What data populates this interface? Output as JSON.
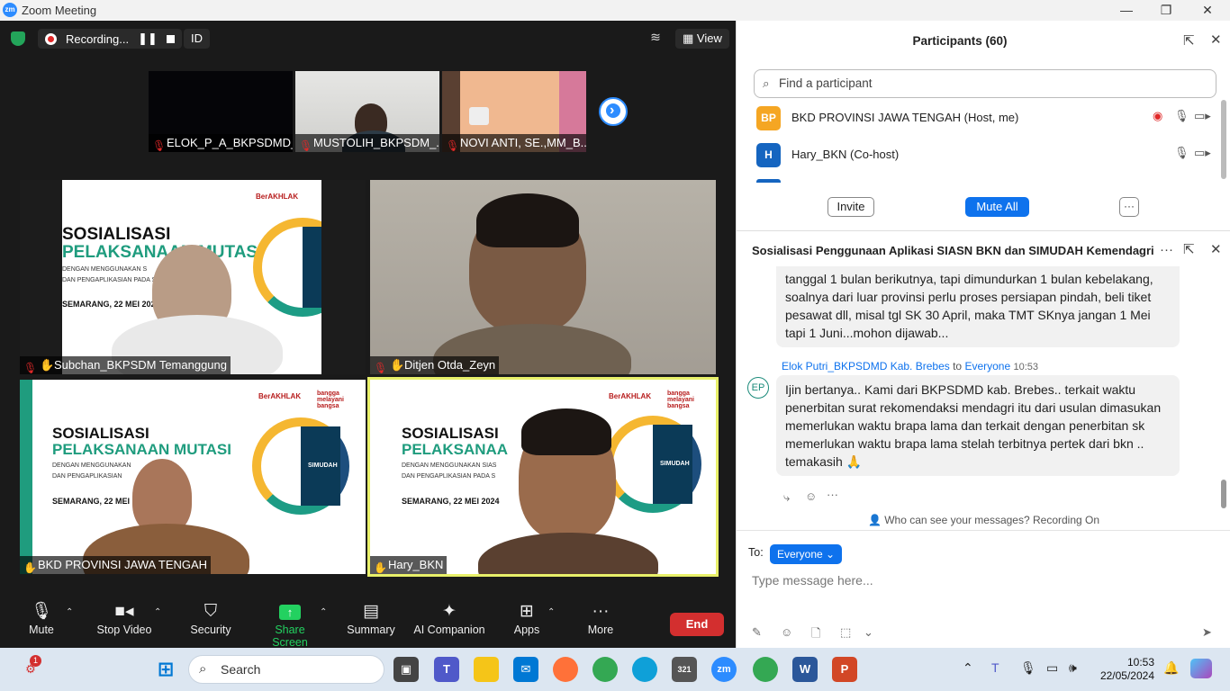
{
  "window": {
    "title": "Zoom Meeting",
    "logo": "zm"
  },
  "topbar": {
    "recording": "Recording...",
    "id_label": "ID",
    "view_label": "View"
  },
  "thumbnails": [
    {
      "name": "ELOK_P_A_BKPSDMD_..."
    },
    {
      "name": "MUSTOLIH_BKPSDM_..."
    },
    {
      "name": "NOVI ANTI, SE.,MM_B..."
    }
  ],
  "tiles": [
    {
      "name": "Subchan_BKPSDM Temanggung",
      "slide": {
        "line1": "SOSIALISASI",
        "line2": "PELAKSANAAN MUTASI",
        "line3": "DENGAN MENGGUNAKAN S",
        "line4": "DAN PENGAPLIKASIAN PADA S",
        "date": "SEMARANG, 22 MEI 2024",
        "badge": "BerAKHLAK"
      }
    },
    {
      "name": "Ditjen Otda_Zeyn"
    },
    {
      "name": "BKD PROVINSI JAWA TENGAH",
      "slide": {
        "line1": "SOSIALISASI",
        "line2": "PELAKSANAAN MUTASI",
        "line3": "DENGAN MENGGUNAKAN",
        "line4": "DAN PENGAPLIKASIAN",
        "date": "SEMARANG, 22 MEI",
        "badge": "BerAKHLAK",
        "badge2": "bangga melayani bangsa",
        "simudah": "SIMUDAH"
      }
    },
    {
      "name": "Hary_BKN",
      "slide": {
        "line1": "SOSIALISASI",
        "line2": "PELAKSANAA",
        "line3": "DENGAN MENGGUNAKAN SIAS",
        "line4": "DAN PENGAPLIKASIAN PADA S",
        "date": "SEMARANG, 22 MEI 2024",
        "badge": "BerAKHLAK",
        "badge2": "bangga melayani bangsa",
        "simudah": "SIMUDAH"
      }
    }
  ],
  "toolbar": {
    "mute": "Mute",
    "stop_video": "Stop Video",
    "security": "Security",
    "share_screen": "Share Screen",
    "summary": "Summary",
    "ai_companion": "AI Companion",
    "apps": "Apps",
    "more": "More",
    "end": "End"
  },
  "participants": {
    "title": "Participants (60)",
    "search_placeholder": "Find a participant",
    "list": [
      {
        "initials": "BP",
        "name": "BKD PROVINSI JAWA TENGAH (Host, me)",
        "color": "#f5a623"
      },
      {
        "initials": "H",
        "name": "Hary_BKN (Co-host)",
        "color": "#1565c0"
      }
    ],
    "invite": "Invite",
    "mute_all": "Mute All",
    "more": "···"
  },
  "chat": {
    "title": "Sosialisasi Penggunaan Aplikasi SIASN BKN dan SIMUDAH Kemendagri",
    "prev_message": "tanggal 1 bulan berikutnya, tapi dimundurkan 1 bulan kebelakang, soalnya dari luar provinsi perlu proses persiapan pindah, beli tiket pesawat dll, misal tgl SK 30 April, maka TMT SKnya jangan 1 Mei tapi 1 Juni...mohon dijawab...",
    "msg": {
      "initials": "EP",
      "sender": "Elok Putri_BKPSDMD Kab. Brebes",
      "to_word": "to",
      "to": "Everyone",
      "time": "10:53",
      "text": "Ijin bertanya.. Kami dari BKPSDMD kab. Brebes.. terkait waktu penerbitan surat rekomendaksi mendagri itu dari usulan dimasukan memerlukan waktu brapa lama dan terkait dengan penerbitan sk memerlukan waktu brapa lama stelah terbitnya pertek dari bkn .. temakasih 🙏"
    },
    "who_can_see": "Who can see your messages? Recording On",
    "to_label": "To:",
    "recipient": "Everyone",
    "input_placeholder": "Type message here..."
  },
  "taskbar": {
    "search": "Search",
    "time": "10:53",
    "date": "22/05/2024",
    "notification_count": "1"
  },
  "colors": {
    "accent": "#0e72ed",
    "end": "#d32f2f",
    "share": "#23d160",
    "active_speaker": "#e8f06a"
  }
}
